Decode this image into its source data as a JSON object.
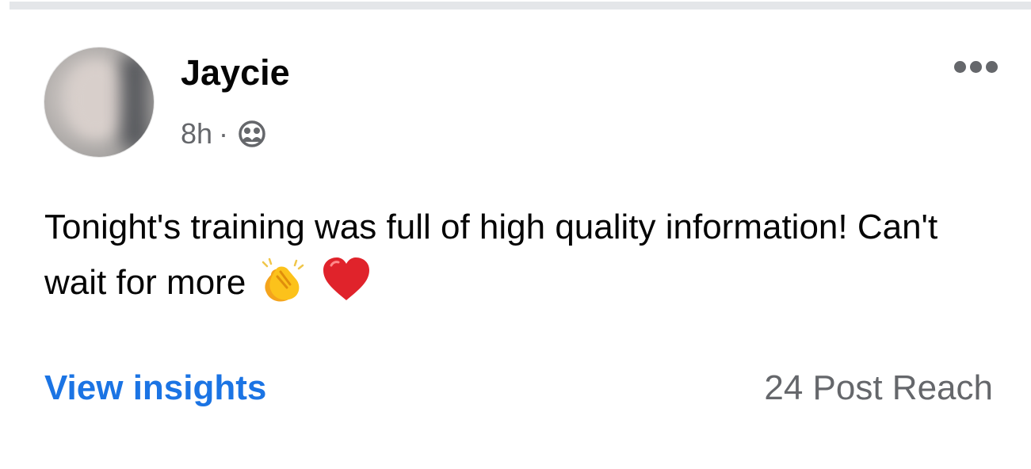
{
  "post": {
    "author": "Jaycie",
    "time": "8h",
    "separator": "·",
    "audience_icon": "friends-icon",
    "text": "Tonight's training was full of high quality information! Can't wait for more",
    "emojis": [
      "clapping-hands-icon",
      "red-heart-icon"
    ],
    "view_insights_label": "View insights",
    "reach_text": "24 Post Reach"
  },
  "colors": {
    "link": "#1b74e4",
    "secondary_text": "#65676b",
    "primary_text": "#050505",
    "divider": "#e4e6e9"
  }
}
